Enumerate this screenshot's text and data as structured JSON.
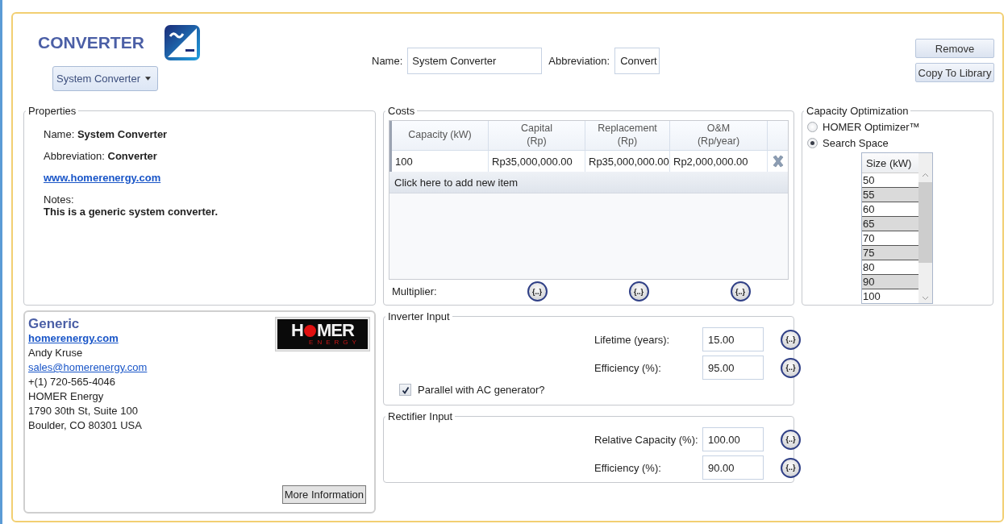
{
  "header": {
    "title": "CONVERTER",
    "component_select": "System Converter",
    "name_label": "Name:",
    "name_value": "System Converter",
    "abbreviation_label": "Abbreviation:",
    "abbreviation_value": "Convert",
    "buttons": [
      "Remove",
      "Copy To Library"
    ]
  },
  "properties": {
    "legend": "Properties",
    "name_label": "Name:",
    "name": "System Converter",
    "abbreviation_label": "Abbreviation:",
    "abbreviation": "Converter",
    "link": "www.homerenergy.com",
    "notes_label": "Notes:",
    "notes": "This is a generic system converter."
  },
  "costs": {
    "legend": "Costs",
    "columns": [
      {
        "title": "Capacity (kW)"
      },
      {
        "title": "Capital",
        "unit": "(Rp)"
      },
      {
        "title": "Replacement",
        "unit": "(Rp)"
      },
      {
        "title": "O&M",
        "unit": "(Rp/year)"
      }
    ],
    "rows": [
      [
        "100",
        "Rp35,000,000.00",
        "Rp35,000,000.00",
        "Rp2,000,000.00"
      ]
    ],
    "add_item": "Click here to add new item",
    "multiplier_label": "Multiplier:",
    "multiplier_buttons": [
      "{..}",
      "{..}",
      "{..}"
    ]
  },
  "capacity_optimization": {
    "legend": "Capacity Optimization",
    "options": [
      {
        "label": "HOMER Optimizer™",
        "selected": false
      },
      {
        "label": "Search Space",
        "selected": true
      }
    ],
    "size_header": "Size (kW)",
    "sizes": [
      "50",
      "55",
      "60",
      "65",
      "70",
      "75",
      "80",
      "90",
      "100"
    ]
  },
  "vendor": {
    "name": "Generic",
    "website": "homerenergy.com",
    "contact": "Andy Kruse",
    "email": "sales@homerenergy.com",
    "phone": "+(1) 720-565-4046",
    "company": "HOMER Energy",
    "address": [
      "1790 30th St, Suite 100",
      "Boulder, CO 80301 USA"
    ],
    "logo": {
      "left": "H",
      "right": "MER",
      "sub": "ENERGY"
    },
    "more_button": "More Information"
  },
  "inverter_input": {
    "legend": "Inverter Input",
    "fields": [
      {
        "label": "Lifetime (years):",
        "value": "15.00",
        "button": "{..}"
      },
      {
        "label": "Efficiency (%):",
        "value": "95.00",
        "button": "{..}"
      }
    ],
    "parallel": {
      "label": "Parallel with AC generator?",
      "checked": true
    }
  },
  "rectifier_input": {
    "legend": "Rectifier Input",
    "fields": [
      {
        "label": "Relative Capacity (%):",
        "value": "100.00",
        "button": "{..}"
      },
      {
        "label": "Efficiency (%):",
        "value": "90.00",
        "button": "{..}"
      }
    ]
  }
}
